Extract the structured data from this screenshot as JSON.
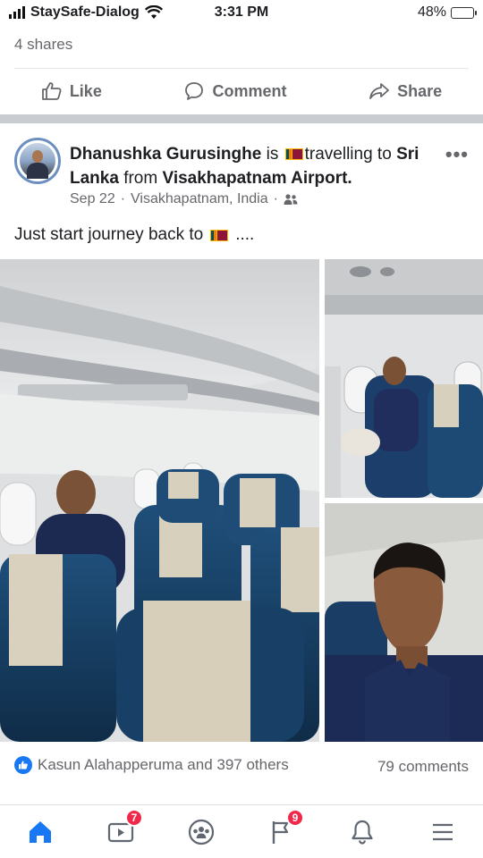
{
  "status_bar": {
    "carrier": "StaySafe-Dialog",
    "time": "3:31 PM",
    "battery": "48%",
    "battery_level": 0.48,
    "battery_color": "#f6c700"
  },
  "previous_post": {
    "shares": "4 shares",
    "actions": {
      "like": "Like",
      "comment": "Comment",
      "share": "Share"
    }
  },
  "post": {
    "author": "Dhanushka Gurusinghe",
    "is_text": "is",
    "activity": "travelling to",
    "destination": "Sri Lanka",
    "from_text": "from",
    "origin": "Visakhapatnam Airport.",
    "date": "Sep 22",
    "location": "Visakhapatnam, India",
    "privacy_icon": "friends-icon",
    "body_text": "Just start journey back to",
    "body_suffix": "....",
    "photos": [
      "airplane-cabin-seats-photo",
      "man-seated-window-photo",
      "selfie-photo"
    ],
    "reactions_text": "Kasun Alahapperuma and 397 others",
    "comments_text": "79 comments"
  },
  "bottom_nav": {
    "items": [
      {
        "name": "home",
        "badge": ""
      },
      {
        "name": "watch",
        "badge": "7"
      },
      {
        "name": "groups",
        "badge": ""
      },
      {
        "name": "pages",
        "badge": "9"
      },
      {
        "name": "notifications",
        "badge": ""
      },
      {
        "name": "menu",
        "badge": ""
      }
    ],
    "active_color": "#1877f2",
    "badge_color": "#f02849"
  }
}
